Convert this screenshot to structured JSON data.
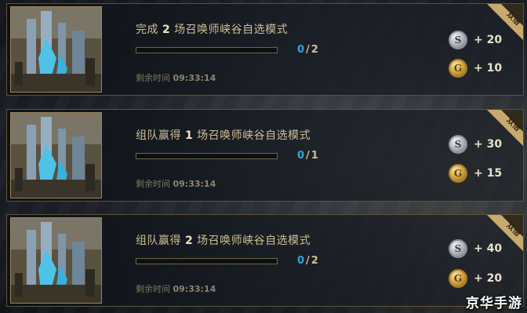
{
  "missions": [
    {
      "title_pre": "完成 ",
      "title_num": "2",
      "title_post": " 场召唤师峡谷自选模式",
      "progress_current": "0",
      "progress_sep": "/",
      "progress_total": "2",
      "progress_fraction": 0,
      "time_label": "剩余时间",
      "time_value": "09:33:14",
      "badge": "双倍",
      "silver_icon": "silver-coin-icon",
      "silver_letter": "S",
      "silver_reward": "+ 20",
      "gold_icon": "gold-coin-icon",
      "gold_letter": "G",
      "gold_reward": "+ 10"
    },
    {
      "title_pre": "组队赢得 ",
      "title_num": "1",
      "title_post": " 场召唤师峡谷自选模式",
      "progress_current": "0",
      "progress_sep": "/",
      "progress_total": "1",
      "progress_fraction": 0,
      "time_label": "剩余时间",
      "time_value": "09:33:14",
      "badge": "双倍",
      "silver_icon": "silver-coin-icon",
      "silver_letter": "S",
      "silver_reward": "+ 30",
      "gold_icon": "gold-coin-icon",
      "gold_letter": "G",
      "gold_reward": "+ 15"
    },
    {
      "title_pre": "组队赢得 ",
      "title_num": "2",
      "title_post": " 场召唤师峡谷自选模式",
      "progress_current": "0",
      "progress_sep": "/",
      "progress_total": "2",
      "progress_fraction": 0,
      "time_label": "剩余时间",
      "time_value": "09:33:14",
      "badge": "双倍",
      "silver_icon": "silver-coin-icon",
      "silver_letter": "S",
      "silver_reward": "+ 40",
      "gold_icon": "gold-coin-icon",
      "gold_letter": "G",
      "gold_reward": "+ 20"
    }
  ],
  "watermark": "京华手游",
  "colors": {
    "accent_gold": "#c8aa6e",
    "progress_blue": "#2ea7d6",
    "title_text": "#cdbf98"
  }
}
